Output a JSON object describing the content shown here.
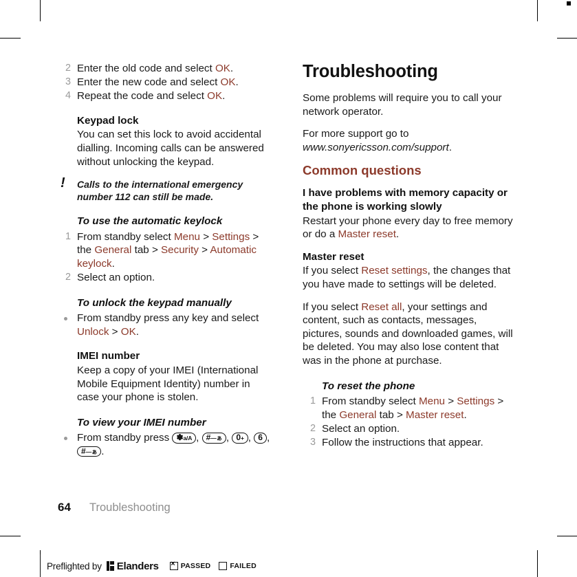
{
  "document": {
    "page_number": "64",
    "chapter": "Troubleshooting"
  },
  "left_column": {
    "steps_change_code": [
      {
        "num": "2",
        "text_before": "Enter the old code and select ",
        "link": "OK",
        "text_after": "."
      },
      {
        "num": "3",
        "text_before": "Enter the new code and select ",
        "link": "OK",
        "text_after": "."
      },
      {
        "num": "4",
        "text_before": "Repeat the code and select ",
        "link": "OK",
        "text_after": "."
      }
    ],
    "keypad_lock": {
      "heading": "Keypad lock",
      "body": "You can set this lock to avoid accidental dialling. Incoming calls can be answered without unlocking the keypad."
    },
    "note": {
      "icon": "exclamation-icon",
      "text": "Calls to the international emergency number 112 can still be made."
    },
    "automatic_keylock": {
      "heading": "To use the automatic keylock",
      "step1": {
        "num": "1",
        "p1": "From standby select ",
        "l1": "Menu",
        "p2": " > ",
        "l2": "Settings",
        "p3": " > the ",
        "l3": "General",
        "p4": " tab > ",
        "l4": "Security",
        "p5": " > ",
        "l5": "Automatic keylock",
        "p6": "."
      },
      "step2": {
        "num": "2",
        "text": "Select an option."
      }
    },
    "unlock_manually": {
      "heading": "To unlock the keypad manually",
      "bullet": {
        "p1": "From standby press any key and select ",
        "l1": "Unlock",
        "p2": " > ",
        "l2": "OK",
        "p3": "."
      }
    },
    "imei_number": {
      "heading": "IMEI number",
      "body": "Keep a copy of your IMEI (International Mobile Equipment Identity) number in case your phone is stolen."
    },
    "view_imei": {
      "heading": "To view your IMEI number",
      "intro": "From standby press ",
      "keys": [
        {
          "main": "✽",
          "sub": "a/A"
        },
        {
          "main": "#",
          "sub": "—ぁ"
        },
        {
          "main": "0",
          "sub": "+"
        },
        {
          "main": "6",
          "sub": ""
        },
        {
          "main": "#",
          "sub": "—ぁ"
        }
      ],
      "sep": ", ",
      "end": "."
    }
  },
  "right_column": {
    "title": "Troubleshooting",
    "intro1": "Some problems will require you to call your network operator.",
    "intro2_before": "For more support go to ",
    "intro2_url": "www.sonyericsson.com/support",
    "intro2_after": ".",
    "common_questions_heading": "Common questions",
    "memory_question": {
      "heading": "I have problems with memory capacity or the phone is working slowly",
      "p1": "Restart your phone every day to free memory or do a ",
      "l1": "Master reset",
      "p2": "."
    },
    "master_reset": {
      "heading": "Master reset",
      "para1_p1": "If you select ",
      "para1_l1": "Reset settings",
      "para1_p2": ", the changes that you have made to settings will be deleted.",
      "para2_p1": "If you select ",
      "para2_l1": "Reset all",
      "para2_p2": ", your settings and content, such as contacts, messages, pictures, sounds and downloaded games, will be deleted. You may also lose content that was in the phone at purchase."
    },
    "reset_phone": {
      "heading": "To reset the phone",
      "step1": {
        "num": "1",
        "p1": "From standby select ",
        "l1": "Menu",
        "p2": " > ",
        "l2": "Settings",
        "p3": " > the ",
        "l3": "General",
        "p4": " tab > ",
        "l4": "Master reset",
        "p5": "."
      },
      "step2": {
        "num": "2",
        "text": "Select an option."
      },
      "step3": {
        "num": "3",
        "text": "Follow the instructions that appear."
      }
    }
  },
  "preflight": {
    "text": "Preflighted by",
    "brand": "Elanders",
    "passed_label": "PASSED",
    "failed_label": "FAILED"
  },
  "colors": {
    "link": "#8c3a2b",
    "heading": "#8c3a2b",
    "body": "#1a1a1a",
    "muted": "#9a9a9a"
  }
}
